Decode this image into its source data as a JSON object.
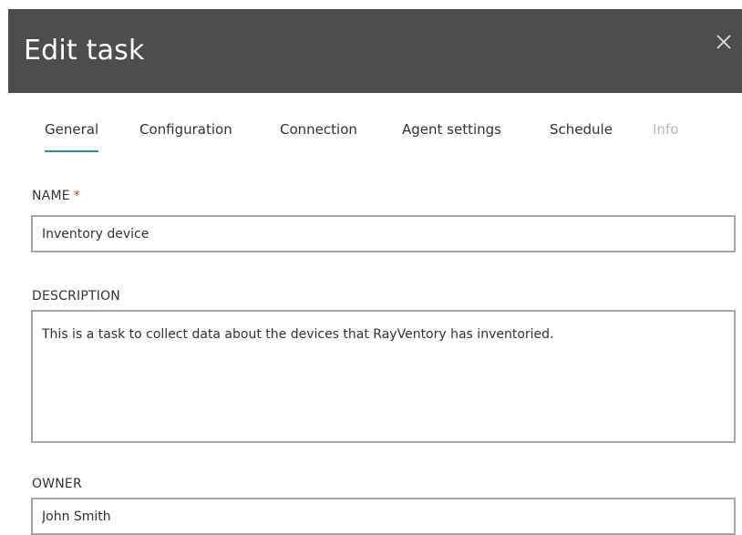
{
  "dialog": {
    "title": "Edit task",
    "close_icon": "close-icon"
  },
  "tabs": [
    {
      "label": "General",
      "state": "active"
    },
    {
      "label": "Configuration",
      "state": "normal"
    },
    {
      "label": "Connection",
      "state": "normal"
    },
    {
      "label": "Agent settings",
      "state": "normal"
    },
    {
      "label": "Schedule",
      "state": "normal"
    },
    {
      "label": "Info",
      "state": "disabled"
    }
  ],
  "form": {
    "name_label": "NAME",
    "name_required_mark": "*",
    "name_value": "Inventory device",
    "description_label": "DESCRIPTION",
    "description_value": "This is a task to collect data about the devices that RayVentory has inventoried.",
    "owner_label": "OWNER",
    "owner_value": "John Smith"
  },
  "colors": {
    "header_bg": "#4d4d4c",
    "active_tab_underline": "#2c8fa6",
    "required_mark": "#d9342b",
    "disabled_tab": "#b9b9b9",
    "field_border": "#a6a6a6"
  }
}
